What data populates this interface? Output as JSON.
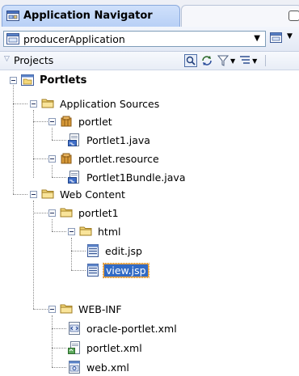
{
  "panel": {
    "title": "Application Navigator",
    "application": "producerApplication",
    "section": "Projects"
  },
  "tree": {
    "portlets": "Portlets",
    "application_sources": "Application Sources",
    "portlet_pkg": "portlet",
    "portlet1_java": "Portlet1.java",
    "portlet_resource_pkg": "portlet.resource",
    "portlet1bundle_java": "Portlet1Bundle.java",
    "web_content": "Web Content",
    "portlet1_folder": "portlet1",
    "html_folder": "html",
    "edit_jsp": "edit.jsp",
    "view_jsp": "view.jsp",
    "web_inf": "WEB-INF",
    "oracle_portlet_xml": "oracle-portlet.xml",
    "portlet_xml": "portlet.xml",
    "web_xml": "web.xml"
  },
  "icons": {
    "navigator": "application-navigator-icon",
    "application": "application-icon",
    "folder": "folder-icon",
    "package": "package-icon",
    "java_file": "java-file-icon",
    "jsp_file": "jsp-file-icon",
    "xml_file": "xml-file-icon"
  },
  "colors": {
    "selection": "#316ac5",
    "tab_active": "#c4d8f8",
    "folder": "#f4d87a"
  }
}
